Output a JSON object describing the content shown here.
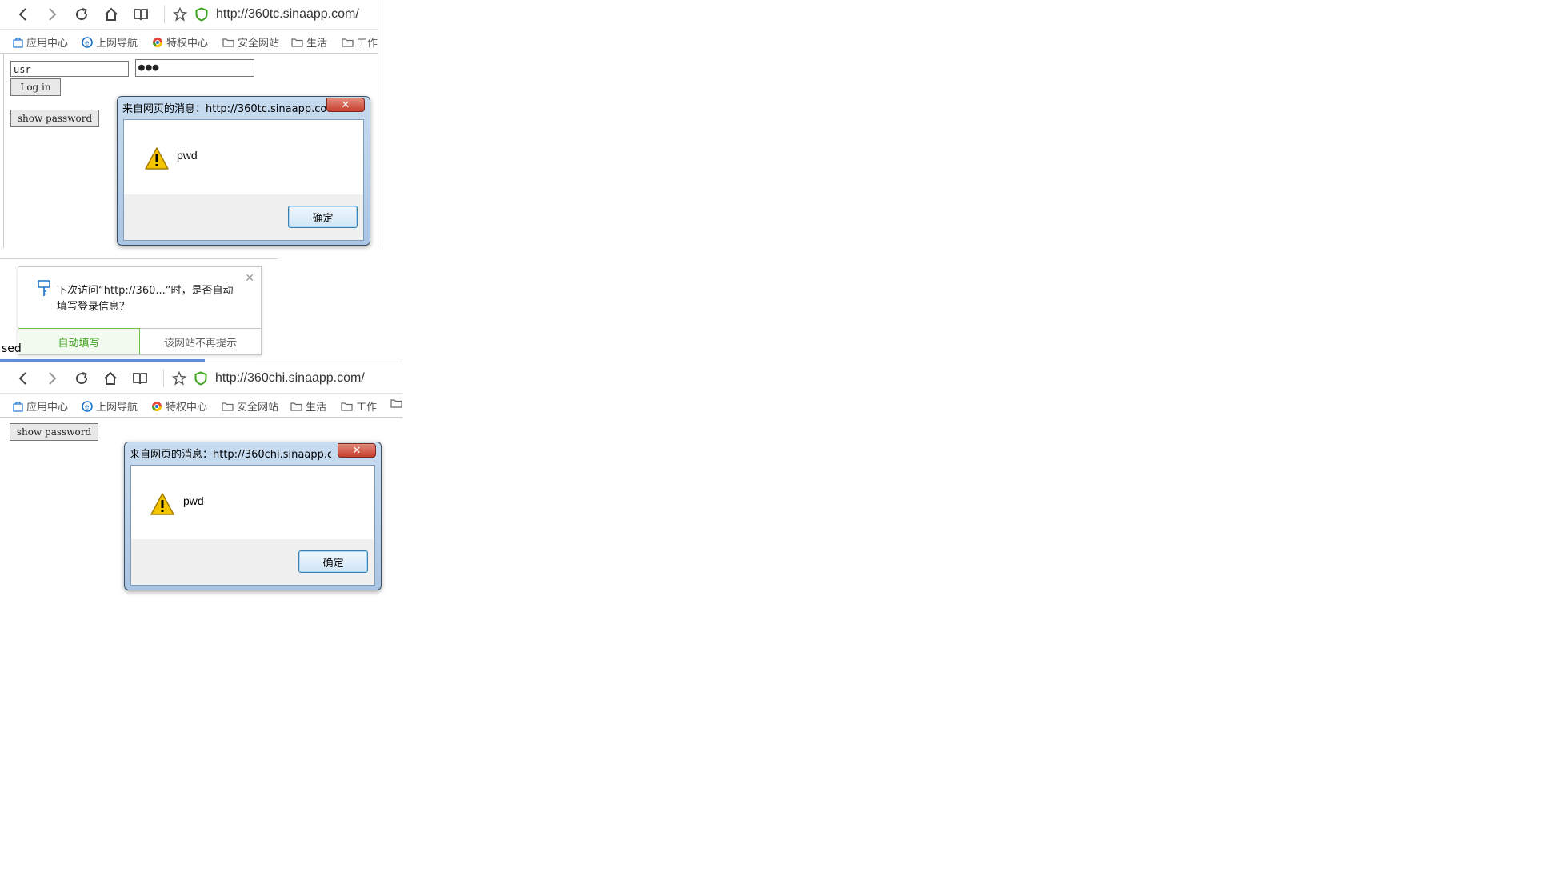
{
  "bookmark_items": [
    "应用中心",
    "上网导航",
    "特权中心",
    "安全网站",
    "生活",
    "工作"
  ],
  "window_top": {
    "url": "http://360tc.sinaapp.com/",
    "username_value": "usr",
    "password_masked": "●●●",
    "login_label": "Log in",
    "show_password_label": "show password"
  },
  "alert_top": {
    "title": "来自网页的消息：http://360tc.sinaapp.com...",
    "close_label": "✕",
    "message": "pwd",
    "ok_label": "确定"
  },
  "autofill_prompt": {
    "message": "下次访问“http://360...”时，是否自动填写登录信息？",
    "close_label": "✕",
    "accept_label": "自动填写",
    "decline_label": "该网站不再提示"
  },
  "partial_text": "sed",
  "window_bottom": {
    "url": "http://360chi.sinaapp.com/",
    "show_password_label": "show password"
  },
  "alert_bottom": {
    "title": "来自网页的消息：http://360chi.sinaapp.co...",
    "close_label": "✕",
    "message": "pwd",
    "ok_label": "确定"
  },
  "colors": {
    "shield_green": "#3fa320",
    "accent_blue": "#1a73c8",
    "warning_yellow": "#f5c400"
  },
  "icons": [
    "back-icon",
    "forward-icon",
    "reload-icon",
    "home-icon",
    "reader-icon",
    "star-icon",
    "shield-icon",
    "folder-icon",
    "warning-icon",
    "key-icon"
  ]
}
